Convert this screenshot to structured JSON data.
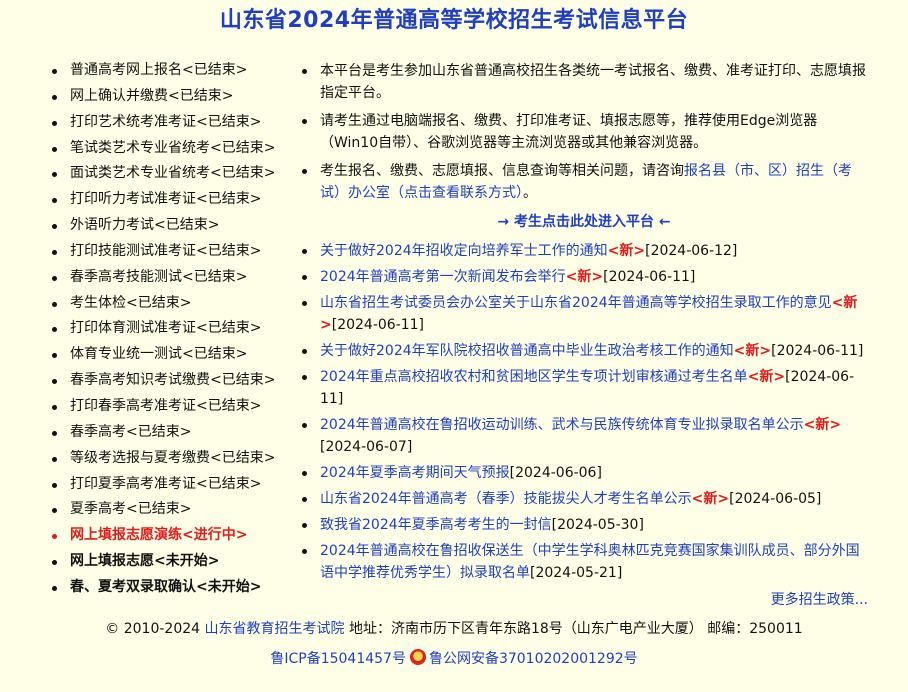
{
  "page": {
    "title": "山东省2024年普通高等学校招生考试信息平台"
  },
  "left_menu": [
    {
      "label": "普通高考网上报名<已结束>",
      "state": "ended"
    },
    {
      "label": "网上确认并缴费<已结束>",
      "state": "ended"
    },
    {
      "label": "打印艺术统考准考证<已结束>",
      "state": "ended"
    },
    {
      "label": "笔试类艺术专业省统考<已结束>",
      "state": "ended"
    },
    {
      "label": "面试类艺术专业省统考<已结束>",
      "state": "ended"
    },
    {
      "label": "打印听力考试准考证<已结束>",
      "state": "ended"
    },
    {
      "label": "外语听力考试<已结束>",
      "state": "ended"
    },
    {
      "label": "打印技能测试准考证<已结束>",
      "state": "ended"
    },
    {
      "label": "春季高考技能测试<已结束>",
      "state": "ended"
    },
    {
      "label": "考生体检<已结束>",
      "state": "ended"
    },
    {
      "label": "打印体育测试准考证<已结束>",
      "state": "ended"
    },
    {
      "label": "体育专业统一测试<已结束>",
      "state": "ended"
    },
    {
      "label": "春季高考知识考试缴费<已结束>",
      "state": "ended"
    },
    {
      "label": "打印春季高考准考证<已结束>",
      "state": "ended"
    },
    {
      "label": "春季高考<已结束>",
      "state": "ended"
    },
    {
      "label": "等级考选报与夏考缴费<已结束>",
      "state": "ended"
    },
    {
      "label": "打印夏季高考准考证<已结束>",
      "state": "ended"
    },
    {
      "label": "夏季高考<已结束>",
      "state": "ended"
    },
    {
      "label": "网上填报志愿演练<进行中>",
      "state": "active"
    },
    {
      "label": "网上填报志愿<未开始>",
      "state": "upcoming"
    },
    {
      "label": "春、夏考双录取确认<未开始>",
      "state": "upcoming"
    }
  ],
  "notices": {
    "n1": "本平台是考生参加山东省普通高校招生各类统一考试报名、缴费、准考证打印、志愿填报指定平台。",
    "n2": "请考生通过电脑端报名、缴费、打印准考证、填报志愿等，推荐使用Edge浏览器（Win10自带）、谷歌浏览器等主流浏览器或其他兼容浏览器。",
    "n3_prefix": "考生报名、缴费、志愿填报、信息查询等相关问题，请咨询",
    "n3_link": "报名县（市、区）招生（考试）办公室（点击查看联系方式）",
    "n3_suffix": "。"
  },
  "enter_link": "→ 考生点击此处进入平台 ←",
  "news_new_tag": "<新>",
  "news": [
    {
      "title": "关于做好2024年招收定向培养军士工作的通知",
      "is_new": true,
      "date": "[2024-06-12]"
    },
    {
      "title": "2024年普通高考第一次新闻发布会举行",
      "is_new": true,
      "date": "[2024-06-11]"
    },
    {
      "title": "山东省招生考试委员会办公室关于山东省2024年普通高等学校招生录取工作的意见",
      "is_new": true,
      "date": "[2024-06-11]"
    },
    {
      "title": "关于做好2024年军队院校招收普通高中毕业生政治考核工作的通知",
      "is_new": true,
      "date": "[2024-06-11]"
    },
    {
      "title": "2024年重点高校招收农村和贫困地区学生专项计划审核通过考生名单",
      "is_new": true,
      "date": "[2024-06-11]"
    },
    {
      "title": "2024年普通高校在鲁招收运动训练、武术与民族传统体育专业拟录取名单公示",
      "is_new": true,
      "date": "[2024-06-07]"
    },
    {
      "title": "2024年夏季高考期间天气预报",
      "is_new": false,
      "date": "[2024-06-06]"
    },
    {
      "title": "山东省2024年普通高考（春季）技能拔尖人才考生名单公示",
      "is_new": true,
      "date": "[2024-06-05]"
    },
    {
      "title": "致我省2024年夏季高考考生的一封信",
      "is_new": false,
      "date": "[2024-05-30]"
    },
    {
      "title": "2024年普通高校在鲁招收保送生（中学生学科奥林匹克竞赛国家集训队成员、部分外国语中学推荐优秀学生）拟录取名单",
      "is_new": false,
      "date": "[2024-05-21]"
    }
  ],
  "more_link": "更多招生政策...",
  "footer": {
    "copyright": "© 2010-2024",
    "org_link": "山东省教育招生考试院",
    "address": "地址：济南市历下区青年东路18号（山东广电产业大厦） 邮编：250011",
    "icp": "鲁ICP备15041457号",
    "police": "鲁公网安备37010202001292号"
  },
  "colors": {
    "background": "#ffffe8",
    "link": "#1f3fbf",
    "active": "#e41a1a",
    "new_tag": "#e41a1a"
  }
}
